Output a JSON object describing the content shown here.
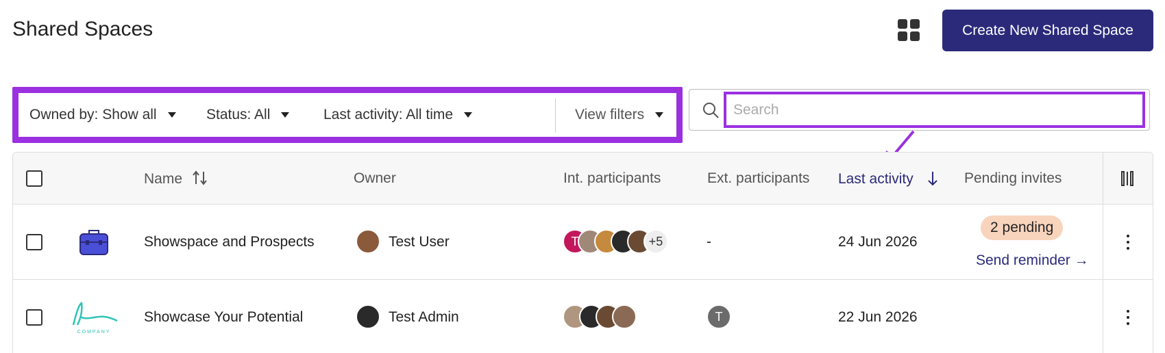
{
  "header": {
    "title": "Shared Spaces",
    "grid_icon": "grid-view-icon",
    "create_label": "Create New Shared Space",
    "accent": "#2b2a7a"
  },
  "filters": {
    "owned_by": "Owned by: Show all",
    "status": "Status: All",
    "last_activity": "Last activity: All time",
    "view_filters": "View filters"
  },
  "search": {
    "placeholder": "Search",
    "value": ""
  },
  "annotation_color": "#9b30e0",
  "table": {
    "columns": {
      "name": "Name",
      "owner": "Owner",
      "int_participants": "Int. participants",
      "ext_participants": "Ext. participants",
      "last_activity": "Last activity",
      "pending_invites": "Pending invites"
    },
    "rows": [
      {
        "name": "Showspace and Prospects",
        "owner": "Test User",
        "int_more": "+5",
        "int_initial": "T",
        "ext": "-",
        "last_activity": "24 Jun 2026",
        "pending": "2 pending",
        "reminder": "Send reminder →"
      },
      {
        "name": "Showcase Your Potential",
        "owner": "Test Admin",
        "logo_text": "COMPANY",
        "ext_initial": "T",
        "last_activity": "22 Jun 2026"
      }
    ]
  }
}
